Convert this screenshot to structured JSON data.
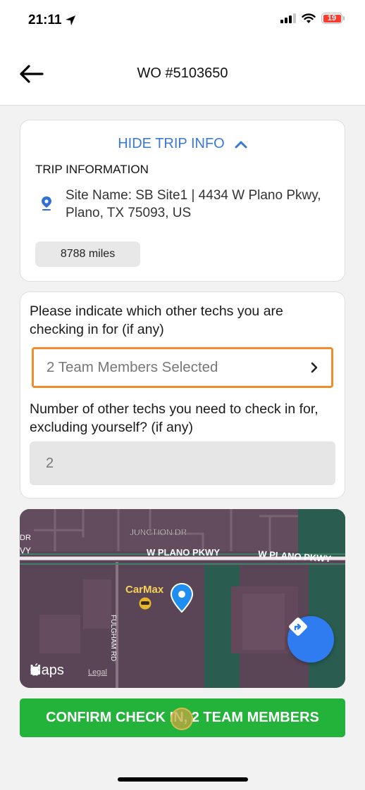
{
  "status_bar": {
    "time": "21:11",
    "battery_level": "19",
    "icons": [
      "location-arrow-icon",
      "cellular-signal-icon",
      "wifi-icon",
      "battery-icon"
    ]
  },
  "header": {
    "back_icon": "back-arrow-icon",
    "title": "WO #5103650"
  },
  "trip_info": {
    "toggle_label": "HIDE TRIP INFO",
    "toggle_icon": "chevron-up-icon",
    "heading": "TRIP INFORMATION",
    "site_icon": "location-pin-icon",
    "site_text": "Site Name: SB Site1 | 4434 W Plano Pkwy, Plano, TX 75093, US",
    "distance": "8788 miles"
  },
  "techs": {
    "question_select": "Please indicate which other techs you are checking in for (if any)",
    "selected_value": "2 Team Members Selected",
    "question_count": "Number of other techs you need to check in for, excluding yourself? (if any)",
    "count_value": "2"
  },
  "map": {
    "labels": {
      "junction": "JUNCTION DR",
      "plano_left": "W PLANO PKWY",
      "plano_right": "W PLANO PKWY",
      "edge_left_top": "DR",
      "edge_left_bottom": "VY",
      "carmax": "CarMax",
      "fulgham": "FULGHAM RD"
    },
    "brand": "Maps",
    "legal": "Legal",
    "directions_icon": "directions-icon"
  },
  "confirm_button": "CONFIRM CHECK IN, 2 TEAM MEMBERS",
  "colors": {
    "accent_blue": "#3a78d6",
    "highlight_orange": "#f08c2b",
    "confirm_green": "#23b23a",
    "battery_red": "#ff3b30",
    "map_base": "#5a4556"
  }
}
